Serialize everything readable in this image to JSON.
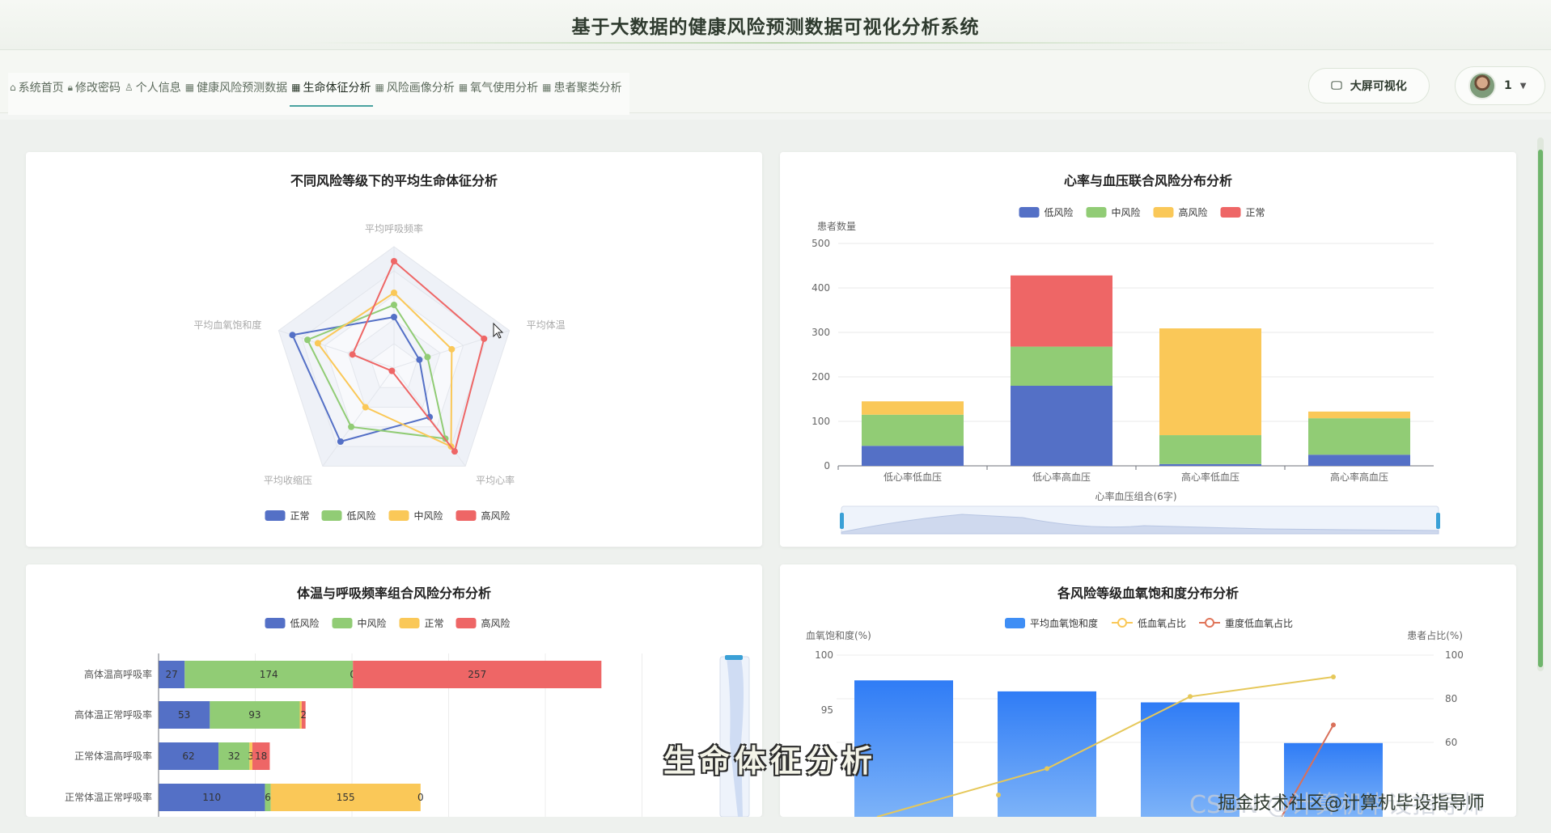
{
  "header": {
    "title": "基于大数据的健康风险预测数据可视化分析系统"
  },
  "nav": {
    "tabs": [
      {
        "label": "系统首页",
        "icon": "home-icon"
      },
      {
        "label": "修改密码",
        "icon": "lock-icon"
      },
      {
        "label": "个人信息",
        "icon": "user-icon"
      },
      {
        "label": "健康风险预测数据",
        "icon": "grid-icon"
      },
      {
        "label": "生命体征分析",
        "icon": "grid-icon",
        "active": true
      },
      {
        "label": "风险画像分析",
        "icon": "grid-icon"
      },
      {
        "label": "氧气使用分析",
        "icon": "grid-icon"
      },
      {
        "label": "患者聚类分析",
        "icon": "grid-icon"
      }
    ],
    "bigscreen_label": "大屏可视化",
    "user_name": "1"
  },
  "colors": {
    "blue": "#5470c6",
    "green": "#91cc75",
    "yellow": "#fac858",
    "red": "#ee6666",
    "accent": "#4aa3a0"
  },
  "chart_data": [
    {
      "type": "radar",
      "title": "不同风险等级下的平均生命体征分析",
      "indicators": [
        "平均呼吸频率",
        "平均体温",
        "平均心率",
        "平均收缩压",
        "平均血氧饱和度"
      ],
      "legend": [
        "正常",
        "低风险",
        "中风险",
        "高风险"
      ],
      "series": [
        {
          "name": "正常",
          "values": [
            0.42,
            0.22,
            0.5,
            0.75,
            0.88
          ]
        },
        {
          "name": "低风险",
          "values": [
            0.52,
            0.29,
            0.72,
            0.6,
            0.75
          ]
        },
        {
          "name": "中风险",
          "values": [
            0.62,
            0.5,
            0.8,
            0.4,
            0.66
          ]
        },
        {
          "name": "高风险",
          "values": [
            0.88,
            0.78,
            0.85,
            0.03,
            0.36
          ]
        }
      ]
    },
    {
      "type": "bar",
      "stacked": true,
      "title": "心率与血压联合风险分布分析",
      "legend": [
        "低风险",
        "中风险",
        "高风险",
        "正常"
      ],
      "ylabel": "患者数量",
      "xlabel": "心率血压组合(6字)",
      "ylim": [
        0,
        500
      ],
      "yticks": [
        0,
        100,
        200,
        300,
        400,
        500
      ],
      "categories": [
        "低心率低血压",
        "低心率高血压",
        "高心率低血压",
        "高心率高血压"
      ],
      "series": [
        {
          "name": "低风险",
          "values": [
            45,
            180,
            4,
            25
          ]
        },
        {
          "name": "中风险",
          "values": [
            70,
            88,
            65,
            82
          ]
        },
        {
          "name": "高风险",
          "values": [
            30,
            0,
            240,
            15
          ]
        },
        {
          "name": "正常",
          "values": [
            0,
            160,
            0,
            0
          ]
        }
      ]
    },
    {
      "type": "bar",
      "orientation": "horizontal",
      "stacked": true,
      "title": "体温与呼吸频率组合风险分布分析",
      "legend": [
        "低风险",
        "中风险",
        "正常",
        "高风险"
      ],
      "categories": [
        "高体温高呼吸率",
        "高体温正常呼吸率",
        "正常体温高呼吸率",
        "正常体温正常呼吸率"
      ],
      "series": [
        {
          "name": "低风险",
          "values": [
            27,
            53,
            62,
            110
          ]
        },
        {
          "name": "中风险",
          "values": [
            174,
            93,
            32,
            6
          ]
        },
        {
          "name": "正常",
          "values": [
            0,
            2,
            3,
            155
          ]
        },
        {
          "name": "高风险",
          "values": [
            257,
            4,
            18,
            0
          ]
        }
      ],
      "labels": [
        [
          "27",
          "174",
          "0",
          "257"
        ],
        [
          "53",
          "93",
          "",
          "2"
        ],
        [
          "62",
          "32",
          "3",
          "18"
        ],
        [
          "110",
          "6",
          "155",
          "0"
        ]
      ]
    },
    {
      "type": "bar-line",
      "title": "各风险等级血氧饱和度分布分析",
      "legend": [
        "平均血氧饱和度",
        "低血氧占比",
        "重度低血氧占比"
      ],
      "ylabel_left": "血氧饱和度(%)",
      "ylabel_right": "患者占比(%)",
      "yticks_left": [
        95,
        100
      ],
      "yticks_right": [
        60,
        80,
        100
      ],
      "ylim_left": [
        91,
        100
      ],
      "ylim_right": [
        40,
        100
      ],
      "bars": [
        97.7,
        96.7,
        95.7,
        92.0
      ],
      "low_oxygen_ratio": [
        30,
        48,
        81,
        90
      ],
      "severe_low_oxygen_ratio": [
        null,
        null,
        30,
        68
      ]
    }
  ],
  "overlay": {
    "caption": "生命体征分析",
    "watermark_gray": "CSDN @计算机毕设指导师",
    "watermark_dark": "掘金技术社区@计算机毕设指导师"
  }
}
